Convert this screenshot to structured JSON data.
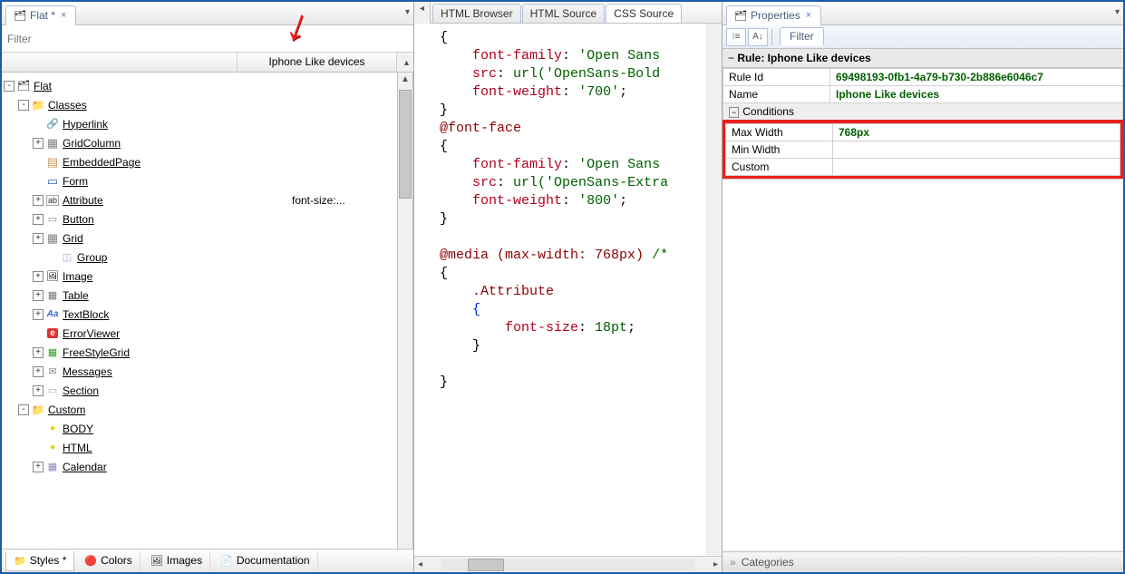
{
  "left": {
    "tab": {
      "label": "Flat *",
      "active": true
    },
    "filter_placeholder": "Filter",
    "column_header": "Iphone Like devices",
    "tree": [
      {
        "depth": 0,
        "toggle": "-",
        "icon": "ic-stack",
        "label": "Flat"
      },
      {
        "depth": 1,
        "toggle": "-",
        "icon": "ic-folder",
        "label": "Classes"
      },
      {
        "depth": 2,
        "toggle": "",
        "icon": "ic-link",
        "label": "Hyperlink"
      },
      {
        "depth": 2,
        "toggle": "+",
        "icon": "ic-grid",
        "label": "GridColumn"
      },
      {
        "depth": 2,
        "toggle": "",
        "icon": "ic-page",
        "label": "EmbeddedPage"
      },
      {
        "depth": 2,
        "toggle": "",
        "icon": "ic-form",
        "label": "Form"
      },
      {
        "depth": 2,
        "toggle": "+",
        "icon": "ic-abl",
        "label": "Attribute",
        "extra": "font-size:..."
      },
      {
        "depth": 2,
        "toggle": "+",
        "icon": "ic-btn",
        "label": "Button"
      },
      {
        "depth": 2,
        "toggle": "+",
        "icon": "ic-grid",
        "label": "Grid"
      },
      {
        "depth": 3,
        "toggle": "",
        "icon": "ic-grp",
        "label": "Group"
      },
      {
        "depth": 2,
        "toggle": "+",
        "icon": "ic-img",
        "label": "Image"
      },
      {
        "depth": 2,
        "toggle": "+",
        "icon": "ic-tbl",
        "label": "Table"
      },
      {
        "depth": 2,
        "toggle": "+",
        "icon": "ic-txt",
        "label": "TextBlock"
      },
      {
        "depth": 2,
        "toggle": "",
        "icon": "ic-err",
        "label": "ErrorViewer"
      },
      {
        "depth": 2,
        "toggle": "+",
        "icon": "ic-fg",
        "label": "FreeStyleGrid"
      },
      {
        "depth": 2,
        "toggle": "+",
        "icon": "ic-msg",
        "label": "Messages"
      },
      {
        "depth": 2,
        "toggle": "+",
        "icon": "ic-sec",
        "label": "Section"
      },
      {
        "depth": 1,
        "toggle": "-",
        "icon": "ic-folder",
        "label": "Custom"
      },
      {
        "depth": 2,
        "toggle": "",
        "icon": "ic-oval",
        "label": "BODY"
      },
      {
        "depth": 2,
        "toggle": "",
        "icon": "ic-oval",
        "label": "HTML"
      },
      {
        "depth": 2,
        "toggle": "+",
        "icon": "ic-cal",
        "label": "Calendar"
      }
    ],
    "bottom_tabs": [
      {
        "icon": "📁",
        "label": "Styles *",
        "active": true
      },
      {
        "icon": "🔴",
        "label": "Colors"
      },
      {
        "icon": "🖼",
        "label": "Images"
      },
      {
        "icon": "📄",
        "label": "Documentation"
      }
    ]
  },
  "middle": {
    "editor_tabs": [
      {
        "label": "HTML Browser",
        "active": false
      },
      {
        "label": "HTML Source",
        "active": false
      },
      {
        "label": "CSS Source",
        "active": true
      }
    ],
    "code_lines": [
      {
        "indent": 1,
        "parts": [
          {
            "t": "{",
            "c": ""
          }
        ]
      },
      {
        "indent": 3,
        "parts": [
          {
            "t": "font-family",
            "c": "kw"
          },
          {
            "t": ": ",
            "c": ""
          },
          {
            "t": "'Open Sans",
            "c": "val"
          }
        ]
      },
      {
        "indent": 3,
        "parts": [
          {
            "t": "src",
            "c": "kw"
          },
          {
            "t": ": ",
            "c": ""
          },
          {
            "t": "url('OpenSans-Bold",
            "c": "val"
          }
        ]
      },
      {
        "indent": 3,
        "parts": [
          {
            "t": "font-weight",
            "c": "kw"
          },
          {
            "t": ": ",
            "c": ""
          },
          {
            "t": "'700'",
            "c": "val"
          },
          {
            "t": ";",
            "c": ""
          }
        ]
      },
      {
        "indent": 1,
        "parts": [
          {
            "t": "}",
            "c": ""
          }
        ]
      },
      {
        "indent": 1,
        "parts": [
          {
            "t": "@font-face",
            "c": "sel"
          }
        ]
      },
      {
        "indent": 1,
        "parts": [
          {
            "t": "{",
            "c": ""
          }
        ]
      },
      {
        "indent": 3,
        "parts": [
          {
            "t": "font-family",
            "c": "kw"
          },
          {
            "t": ": ",
            "c": ""
          },
          {
            "t": "'Open Sans",
            "c": "val"
          }
        ]
      },
      {
        "indent": 3,
        "parts": [
          {
            "t": "src",
            "c": "kw"
          },
          {
            "t": ": ",
            "c": ""
          },
          {
            "t": "url('OpenSans-Extra",
            "c": "val"
          }
        ]
      },
      {
        "indent": 3,
        "parts": [
          {
            "t": "font-weight",
            "c": "kw"
          },
          {
            "t": ": ",
            "c": ""
          },
          {
            "t": "'800'",
            "c": "val"
          },
          {
            "t": ";",
            "c": ""
          }
        ]
      },
      {
        "indent": 1,
        "parts": [
          {
            "t": "}",
            "c": ""
          }
        ]
      },
      {
        "indent": 1,
        "parts": [
          {
            "t": "",
            "c": ""
          }
        ]
      },
      {
        "indent": 1,
        "parts": [
          {
            "t": "@media (max-width: 768px) ",
            "c": "sel"
          },
          {
            "t": "/*",
            "c": "val"
          }
        ]
      },
      {
        "indent": 1,
        "parts": [
          {
            "t": "{",
            "c": ""
          }
        ]
      },
      {
        "indent": 3,
        "parts": [
          {
            "t": ".Attribute",
            "c": "sel"
          }
        ]
      },
      {
        "indent": 3,
        "parts": [
          {
            "t": "{",
            "c": "cur"
          }
        ]
      },
      {
        "indent": 5,
        "parts": [
          {
            "t": "font-size",
            "c": "kw"
          },
          {
            "t": ": ",
            "c": ""
          },
          {
            "t": "18pt",
            "c": "val"
          },
          {
            "t": ";",
            "c": ""
          }
        ]
      },
      {
        "indent": 3,
        "parts": [
          {
            "t": "}",
            "c": ""
          }
        ]
      },
      {
        "indent": 1,
        "parts": [
          {
            "t": "",
            "c": ""
          }
        ]
      },
      {
        "indent": 1,
        "parts": [
          {
            "t": "}",
            "c": ""
          }
        ]
      }
    ]
  },
  "right": {
    "tab": {
      "label": "Properties"
    },
    "filter_label": "Filter",
    "header": "Rule: Iphone Like devices",
    "rows": [
      {
        "key": "Rule Id",
        "val": "69498193-0fb1-4a79-b730-2b886e6046c7",
        "bold": true
      },
      {
        "key": "Name",
        "val": "Iphone Like devices",
        "bold": true
      }
    ],
    "section": "Conditions",
    "cond_rows": [
      {
        "key": "Max Width",
        "val": "768px",
        "bold": true
      },
      {
        "key": "Min Width",
        "val": ""
      },
      {
        "key": "Custom",
        "val": ""
      }
    ],
    "categories": "Categories"
  }
}
